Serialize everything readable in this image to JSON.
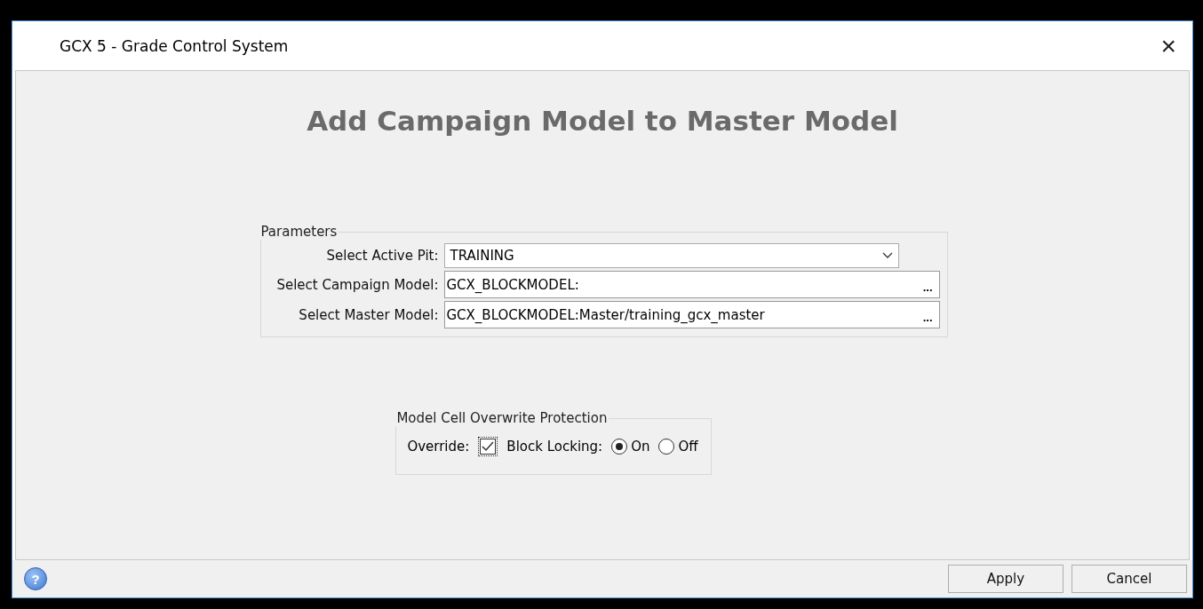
{
  "window": {
    "title": "GCX 5 - Grade Control System",
    "close": "×"
  },
  "heading": "Add Campaign Model to Master Model",
  "parameters": {
    "legend": "Parameters",
    "rows": [
      {
        "kind": "dropdown",
        "label": "Select Active Pit:",
        "value": "TRAINING"
      },
      {
        "kind": "browse",
        "label": "Select Campaign Model:",
        "value": "GCX_BLOCKMODEL:",
        "button": "..."
      },
      {
        "kind": "browse",
        "label": "Select Master Model:",
        "value": "GCX_BLOCKMODEL:Master/training_gcx_master",
        "button": "..."
      }
    ]
  },
  "protection": {
    "legend": "Model Cell Overwrite Protection",
    "override_label": "Override:",
    "override_checked": true,
    "locking_label": "Block Locking:",
    "options": [
      {
        "label": "On",
        "selected": true
      },
      {
        "label": "Off",
        "selected": false
      }
    ]
  },
  "footer": {
    "help": "?",
    "buttons": [
      "Apply",
      "Cancel"
    ]
  }
}
